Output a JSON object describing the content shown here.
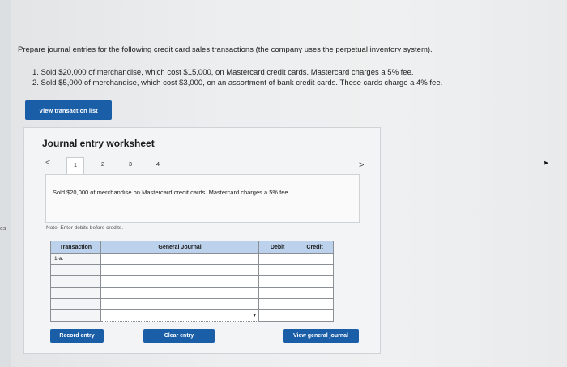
{
  "left_strip": {
    "text": "es"
  },
  "instructions": {
    "intro": "Prepare journal entries for the following credit card sales transactions (the company uses the perpetual inventory system).",
    "items": [
      "1. Sold $20,000 of merchandise, which cost $15,000, on Mastercard credit cards. Mastercard charges a 5% fee.",
      "2. Sold $5,000 of merchandise, which cost $3,000, on an assortment of bank credit cards. These cards charge a 4% fee."
    ]
  },
  "buttons": {
    "view_transaction_list": "View transaction list",
    "record_entry": "Record entry",
    "clear_entry": "Clear entry",
    "view_general_journal": "View general journal"
  },
  "worksheet": {
    "title": "Journal entry worksheet",
    "nav_prev": "<",
    "nav_next": ">",
    "tabs": [
      "1",
      "2",
      "3",
      "4"
    ],
    "active_tab": "1",
    "description": "Sold $20,000 of merchandise on Mastercard credit cards. Mastercard charges a 5% fee.",
    "note": "Note: Enter debits before credits."
  },
  "table": {
    "headers": [
      "Transaction",
      "General Journal",
      "Debit",
      "Credit"
    ],
    "rows": [
      {
        "transaction": "1-a.",
        "general_journal": "",
        "debit": "",
        "credit": ""
      },
      {
        "transaction": "",
        "general_journal": "",
        "debit": "",
        "credit": ""
      },
      {
        "transaction": "",
        "general_journal": "",
        "debit": "",
        "credit": ""
      },
      {
        "transaction": "",
        "general_journal": "",
        "debit": "",
        "credit": ""
      },
      {
        "transaction": "",
        "general_journal": "",
        "debit": "",
        "credit": ""
      },
      {
        "transaction": "",
        "general_journal": "",
        "debit": "",
        "credit": ""
      }
    ]
  },
  "colors": {
    "button_blue": "#1a5ea8",
    "header_blue": "#bcd2ec"
  }
}
